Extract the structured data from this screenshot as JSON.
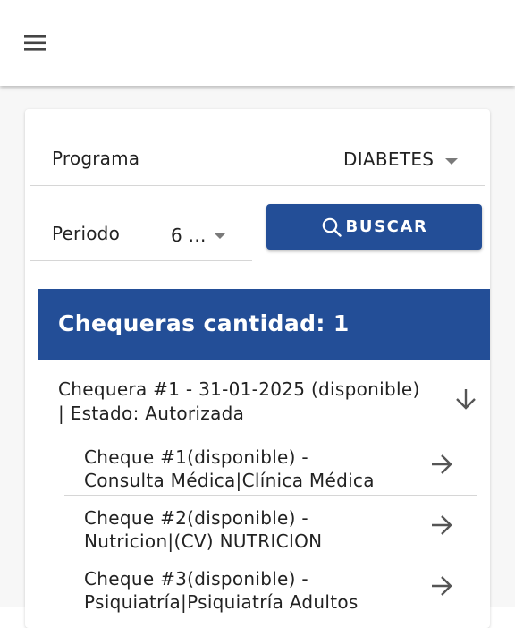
{
  "appbar": {
    "menu_icon": "hamburger-menu-icon"
  },
  "filters": {
    "programa_label": "Programa",
    "programa_value": "DIABETES",
    "periodo_label": "Periodo",
    "periodo_value": "6 ...",
    "buscar_label": "BUSCAR"
  },
  "panel": {
    "header": "Chequeras cantidad: 1",
    "chequera": {
      "line1": "Chequera #1 - 31-01-2025 (disponible)",
      "line2": "| Estado: Autorizada"
    },
    "cheques": [
      {
        "line1": "Cheque #1(disponible) -",
        "line2": "Consulta Médica|Clínica Médica"
      },
      {
        "line1": "Cheque #2(disponible) -",
        "line2": "Nutricion|(CV) NUTRICION"
      },
      {
        "line1": "Cheque #3(disponible) -",
        "line2": "Psiquiatría|Psiquiatría Adultos"
      }
    ]
  },
  "colors": {
    "primary": "#234e97",
    "divider": "#d6d6d6",
    "icon_gray": "#555555"
  }
}
